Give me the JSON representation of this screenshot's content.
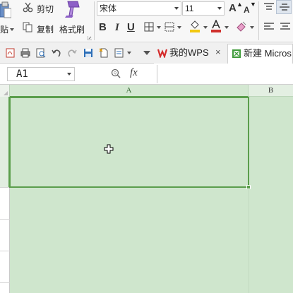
{
  "ribbon": {
    "clipboard": {
      "cut_label": "剪切",
      "copy_label": "复制",
      "paste_label": "贴",
      "format_painter_label": "格式刷",
      "icons": [
        "paste-icon",
        "scissors-icon",
        "copy-icon",
        "format-painter-icon"
      ]
    },
    "font": {
      "family": "宋体",
      "size": "11",
      "bold": "B",
      "italic": "I",
      "underline": "U",
      "grow_label": "A",
      "shrink_label": "A",
      "font_color": "#d0312d",
      "fill_color": "#f2c811"
    }
  },
  "quick_access": {
    "icons": [
      "export-pdf-icon",
      "print-icon",
      "print-preview-icon",
      "undo-icon",
      "redo-icon",
      "save-icon",
      "new-icon",
      "checklist-icon",
      "more-icon"
    ]
  },
  "tabs": [
    {
      "label": "我的WPS",
      "icon": "wps-logo-icon",
      "close": "×"
    },
    {
      "label": "新建 Micros",
      "icon": "spreadsheet-doc-icon"
    }
  ],
  "formula_bar": {
    "name_box": "A1",
    "fx": "fx",
    "formula": ""
  },
  "sheet": {
    "columns": [
      "A",
      "B"
    ],
    "selected_cell": "A1",
    "grid_color": "#cfe6cd",
    "selection_color": "#5b9e4c"
  }
}
